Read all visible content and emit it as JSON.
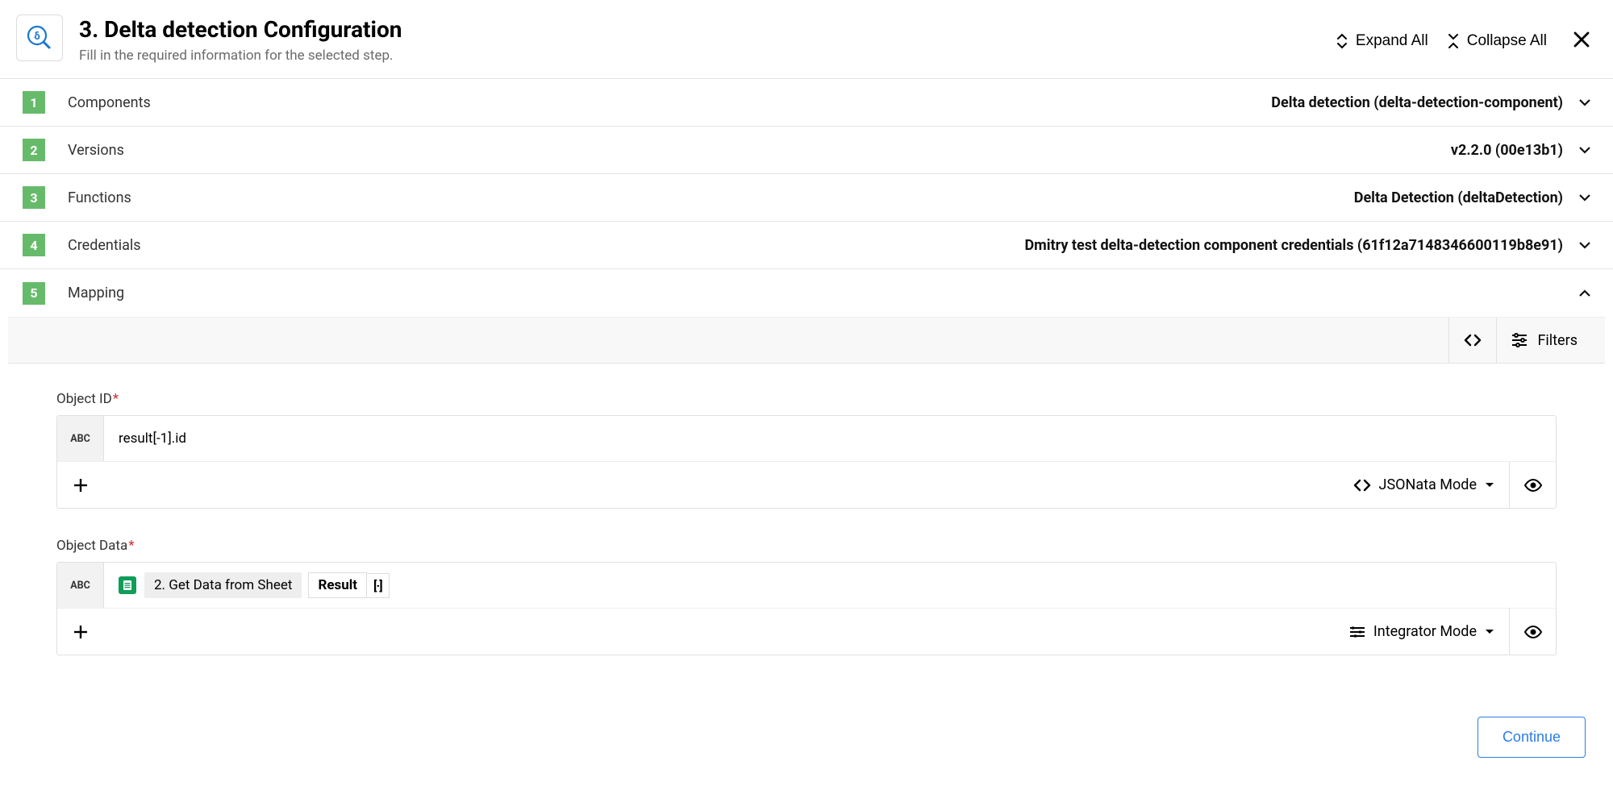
{
  "header": {
    "title": "3. Delta detection Configuration",
    "subtitle": "Fill in the required information for the selected step.",
    "expand_label": "Expand All",
    "collapse_label": "Collapse All"
  },
  "sections": {
    "components": {
      "num": "1",
      "label": "Components",
      "value": "Delta detection (delta-detection-component)"
    },
    "versions": {
      "num": "2",
      "label": "Versions",
      "value": "v2.2.0 (00e13b1)"
    },
    "functions": {
      "num": "3",
      "label": "Functions",
      "value": "Delta Detection (deltaDetection)"
    },
    "credentials": {
      "num": "4",
      "label": "Credentials",
      "value": "Dmitry test delta-detection component credentials (61f12a7148346600119b8e91)"
    },
    "mapping": {
      "num": "5",
      "label": "Mapping",
      "value": ""
    }
  },
  "toolbar": {
    "filters_label": "Filters"
  },
  "fields": {
    "object_id": {
      "label": "Object ID",
      "type_tag": "ABC",
      "value": "result[-1].id",
      "mode_label": "JSONata Mode"
    },
    "object_data": {
      "label": "Object Data",
      "type_tag": "ABC",
      "chip_source": "2. Get Data from Sheet",
      "chip_field": "Result",
      "chip_bracket": "[·]",
      "mode_label": "Integrator Mode"
    }
  },
  "footer": {
    "continue_label": "Continue"
  }
}
